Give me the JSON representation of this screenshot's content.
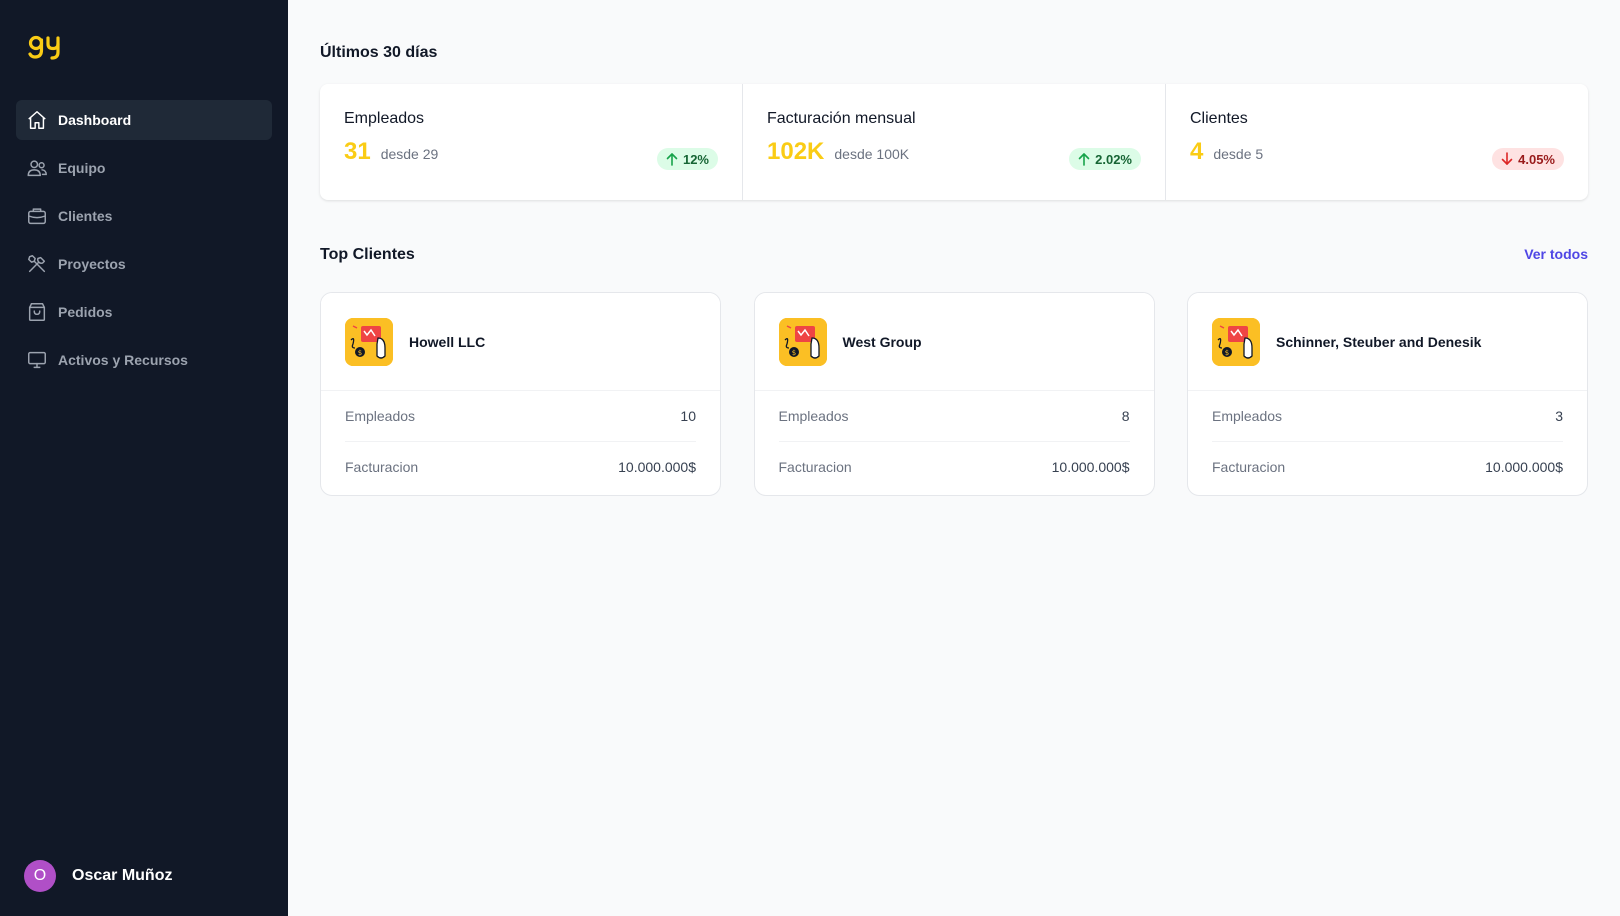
{
  "app": {
    "logo_text": "gy"
  },
  "sidebar": {
    "items": [
      {
        "label": "Dashboard",
        "icon": "home-icon",
        "active": true
      },
      {
        "label": "Equipo",
        "icon": "users-icon"
      },
      {
        "label": "Clientes",
        "icon": "briefcase-icon"
      },
      {
        "label": "Proyectos",
        "icon": "tools-icon"
      },
      {
        "label": "Pedidos",
        "icon": "shopping-bag-icon"
      },
      {
        "label": "Activos y Recursos",
        "icon": "monitor-icon"
      }
    ],
    "user": {
      "initial": "O",
      "name": "Oscar Muñoz",
      "avatar_color": "#b04fc7"
    }
  },
  "stats": {
    "title": "Últimos 30 días",
    "items": [
      {
        "label": "Empleados",
        "value": "31",
        "from": "desde 29",
        "change": "12%",
        "trend": "up"
      },
      {
        "label": "Facturación mensual",
        "value": "102K",
        "from": "desde 100K",
        "change": "2.02%",
        "trend": "up"
      },
      {
        "label": "Clientes",
        "value": "4",
        "from": "desde 5",
        "change": "4.05%",
        "trend": "down"
      }
    ]
  },
  "top_clients": {
    "title": "Top Clientes",
    "view_all": "Ver todos",
    "clients": [
      {
        "name": "Howell LLC",
        "employees_label": "Empleados",
        "employees": "10",
        "billing_label": "Facturacion",
        "billing": "10.000.000$"
      },
      {
        "name": "West Group",
        "employees_label": "Empleados",
        "employees": "8",
        "billing_label": "Facturacion",
        "billing": "10.000.000$"
      },
      {
        "name": "Schinner, Steuber and Denesik",
        "employees_label": "Empleados",
        "employees": "3",
        "billing_label": "Facturacion",
        "billing": "10.000.000$"
      }
    ]
  },
  "colors": {
    "sidebar_bg": "#111827",
    "accent_yellow": "#facc15",
    "link": "#4f46e5",
    "up_badge": "#dcfce7",
    "down_badge": "#fee2e2"
  }
}
